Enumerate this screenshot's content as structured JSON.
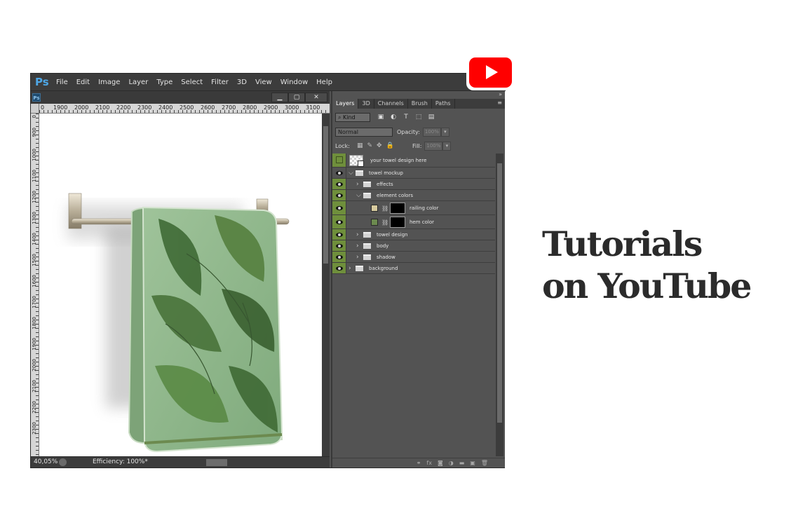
{
  "app": {
    "logo": "Ps",
    "menu": [
      "File",
      "Edit",
      "Image",
      "Layer",
      "Type",
      "Select",
      "Filter",
      "3D",
      "View",
      "Window",
      "Help"
    ]
  },
  "document": {
    "tab_icon": "Ps",
    "window_buttons": [
      "▁",
      "▢",
      "✕"
    ],
    "ruler_h": [
      "0",
      "1900",
      "2000",
      "2100",
      "2200",
      "2300",
      "2400",
      "2500",
      "2600",
      "2700",
      "2800",
      "2900",
      "3000",
      "3100"
    ],
    "ruler_v": [
      "0",
      "900",
      "1000",
      "1100",
      "1200",
      "1300",
      "1400",
      "1500",
      "1600",
      "1700",
      "1800",
      "1900",
      "2000",
      "2100",
      "2200",
      "2300"
    ],
    "zoom": "40,05%",
    "efficiency": "Efficiency: 100%*"
  },
  "panel": {
    "tabs": [
      "Layers",
      "3D",
      "Channels",
      "Brush",
      "Paths"
    ],
    "collapse": "»",
    "menu_icon": "≡",
    "kind_label": "⌕ Kind",
    "filter_icons": [
      "image-filter-icon",
      "adjustment-filter-icon",
      "type-filter-icon",
      "shape-filter-icon",
      "smart-object-filter-icon"
    ],
    "filter_glyphs": [
      "▣",
      "◐",
      "T",
      "⬚",
      "▤"
    ],
    "blend_mode": "Normal",
    "opacity_label": "Opacity:",
    "opacity_value": "100%",
    "lock_label": "Lock:",
    "lock_glyphs": [
      "▦",
      "✎",
      "✥",
      "🔒"
    ],
    "fill_label": "Fill:",
    "fill_value": "100%",
    "layers": [
      {
        "name": "your towel design here",
        "type": "smart-object",
        "depth": 0
      },
      {
        "name": "towel mockup",
        "type": "group",
        "expanded": true,
        "depth": 0
      },
      {
        "name": "effects",
        "type": "group",
        "expanded": false,
        "depth": 1
      },
      {
        "name": "element colors",
        "type": "group",
        "expanded": true,
        "depth": 1
      },
      {
        "name": "railing color",
        "type": "fill",
        "swatch": "#d7ca9e",
        "depth": 2
      },
      {
        "name": "hem color",
        "type": "fill",
        "swatch": "#6c8a4f",
        "depth": 2
      },
      {
        "name": "towel design",
        "type": "group",
        "expanded": false,
        "depth": 1
      },
      {
        "name": "body",
        "type": "group",
        "expanded": false,
        "depth": 1
      },
      {
        "name": "shadow",
        "type": "group",
        "expanded": false,
        "depth": 1
      },
      {
        "name": "background",
        "type": "group",
        "expanded": false,
        "depth": 0
      }
    ],
    "footer_glyphs": [
      "⚭",
      "fx",
      "◙",
      "◑",
      "▬",
      "▣",
      "🗑"
    ]
  },
  "youtube": {
    "color": "#ff0000"
  },
  "headline": {
    "line1": "Tutorials",
    "line2": "on YouTube"
  },
  "colors": {
    "ps_bg": "#535353",
    "visibility_green": "#6f8f3c",
    "headline_text": "#2b2b2b"
  }
}
